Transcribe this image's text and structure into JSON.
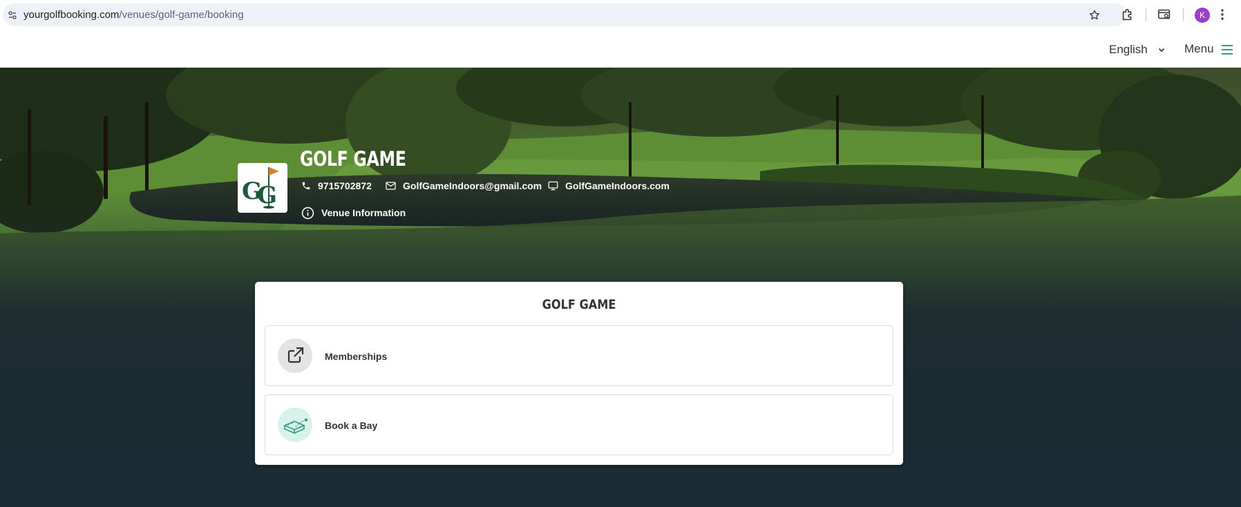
{
  "browser": {
    "url_domain": "yourgolfbooking.com",
    "url_path": "/venues/golf-game/booking",
    "profile_initial": "K",
    "profile_color": "#9c3fc8"
  },
  "header": {
    "language": "English",
    "menu_label": "Menu",
    "accent_color": "#2aa184"
  },
  "venue": {
    "name": "GOLF GAME",
    "phone": "9715702872",
    "email": "GolfGameIndoors@gmail.com",
    "website": "GolfGameIndoors.com",
    "info_label": "Venue Information",
    "logo_letters": "GG",
    "logo_color": "#1d5a3a"
  },
  "card": {
    "title": "GOLF GAME",
    "options": [
      {
        "label": "Memberships",
        "icon": "external-link-icon"
      },
      {
        "label": "Book a Bay",
        "icon": "golf-bay-icon"
      }
    ]
  }
}
